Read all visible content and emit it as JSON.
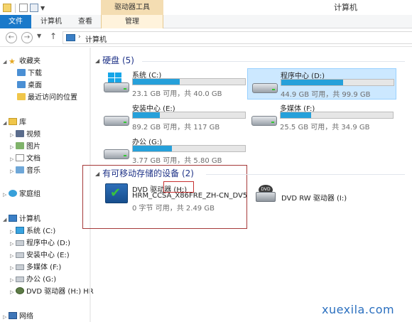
{
  "window": {
    "title": "计算机",
    "context_tab": "驱动器工具"
  },
  "ribbon": {
    "tabs": [
      "文件",
      "计算机",
      "查看",
      "管理"
    ]
  },
  "address": {
    "path": "计算机"
  },
  "nav": {
    "favorites": {
      "label": "收藏夹",
      "items": [
        "下载",
        "桌面",
        "最近访问的位置"
      ]
    },
    "libraries": {
      "label": "库",
      "items": [
        "视频",
        "图片",
        "文档",
        "音乐"
      ]
    },
    "homegroup": "家庭组",
    "computer": {
      "label": "计算机",
      "items": [
        "系统 (C:)",
        "程序中心 (D:)",
        "安装中心 (E:)",
        "多媒体 (F:)",
        "办公 (G:)",
        "DVD 驱动器 (H:) HR"
      ]
    },
    "network": "网络"
  },
  "groups": {
    "hard_disks": "硬盘 (5)",
    "removable": "有可移动存储的设备 (2)"
  },
  "drives": [
    {
      "name": "系统 (C:)",
      "capacity": "23.1 GB 可用，共 40.0 GB",
      "used_fraction": 0.42,
      "selected": false,
      "windows": true
    },
    {
      "name": "程序中心 (D:)",
      "capacity": "44.9 GB 可用，共 99.9 GB",
      "used_fraction": 0.55,
      "selected": true,
      "windows": false
    },
    {
      "name": "安装中心 (E:)",
      "capacity": "89.2 GB 可用，共 117 GB",
      "used_fraction": 0.24,
      "selected": false,
      "windows": false
    },
    {
      "name": "多媒体 (F:)",
      "capacity": "25.5 GB 可用，共 34.9 GB",
      "used_fraction": 0.27,
      "selected": false,
      "windows": false
    },
    {
      "name": "办公 (G:)",
      "capacity": "3.77 GB 可用，共 5.80 GB",
      "used_fraction": 0.35,
      "selected": false,
      "windows": false
    }
  ],
  "removable_drives": [
    {
      "name": "DVD 驱动器 (H:)",
      "label": "HRM_CCSA_X86FRE_ZH-CN_DV5",
      "capacity": "0 字节 可用，共 2.49 GB"
    },
    {
      "name": "DVD RW 驱动器 (I:)"
    }
  ],
  "watermark": "xuexila.com",
  "colors": {
    "accent": "#1979ca",
    "bar_fill": "#26a0da",
    "selection": "#cce8ff",
    "annotation_red": "#a63a3a"
  }
}
